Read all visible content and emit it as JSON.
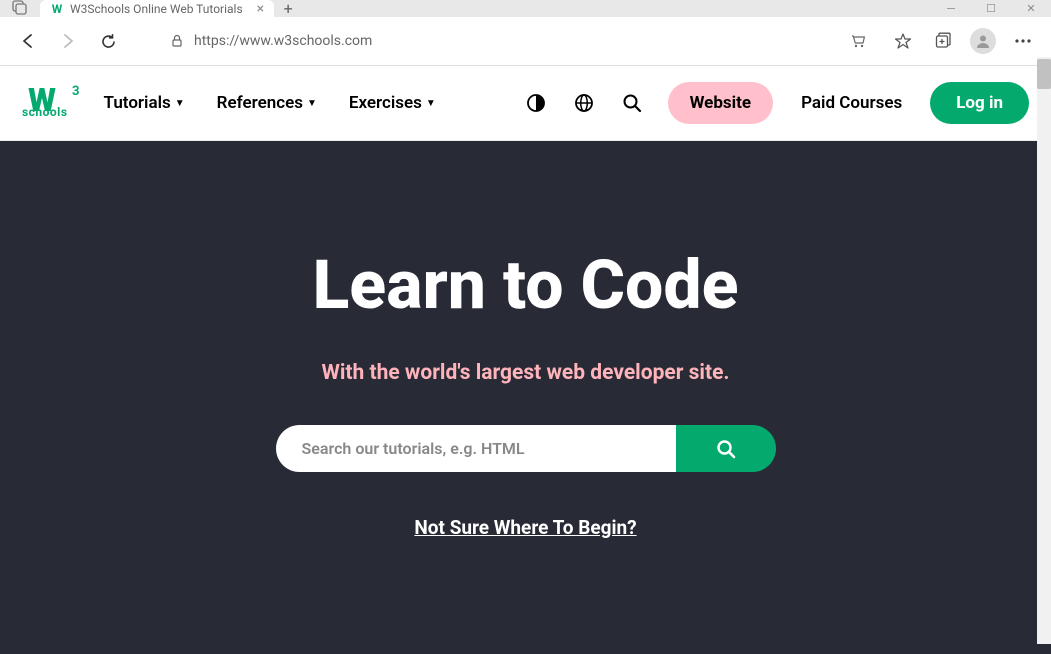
{
  "browser": {
    "tab_title": "W3Schools Online Web Tutorials",
    "url": "https://www.w3schools.com"
  },
  "header": {
    "logo_text": "schools",
    "nav": {
      "tutorials": "Tutorials",
      "references": "References",
      "exercises": "Exercises"
    },
    "website_btn": "Website",
    "paid_courses": "Paid Courses",
    "login": "Log in"
  },
  "hero": {
    "title": "Learn to Code",
    "subtitle": "With the world's largest web developer site.",
    "search_placeholder": "Search our tutorials, e.g. HTML",
    "begin_link": "Not Sure Where To Begin?"
  }
}
